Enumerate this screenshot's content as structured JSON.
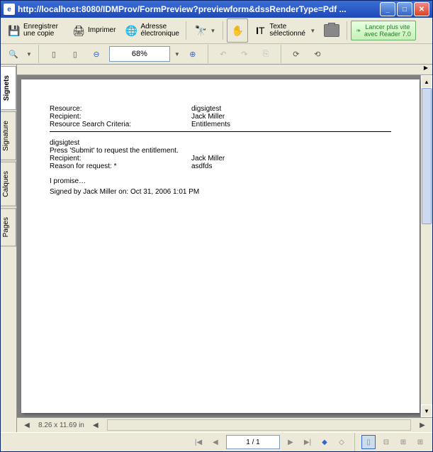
{
  "titlebar": {
    "url": "http://localhost:8080/IDMProv/FormPreview?previewform&dssRenderType=Pdf ..."
  },
  "toolbar": {
    "save": "Enregistrer une copie",
    "print": "Imprimer",
    "address": "Adresse électronique",
    "text_select": "Texte sélectionné"
  },
  "promo": {
    "line1": "Lancer plus vite",
    "line2": "avec Reader 7.0"
  },
  "zoom": {
    "value": "68%"
  },
  "sidetabs": {
    "t1": "Signets",
    "t2": "Signature",
    "t3": "Calques",
    "t4": "Pages"
  },
  "doc": {
    "resource_k": "Resource:",
    "resource_v": "digsigtest",
    "recipient_k": "Recipient:",
    "recipient_v": "Jack Miller",
    "criteria_k": "Resource Search Criteria:",
    "criteria_v": "Entitlements",
    "sec_title": "digsigtest",
    "instr": "Press 'Submit' to request the entitlement.",
    "recipient2_k": "Recipient:",
    "recipient2_v": "Jack Miller",
    "reason_k": "Reason for request: *",
    "reason_v": "asdfds",
    "promise": "I promise…",
    "signed": "Signed by Jack Miller on: Oct 31, 2006 1:01 PM"
  },
  "footer": {
    "dims": "8.26 x 11.69 in",
    "page": "1 / 1"
  }
}
